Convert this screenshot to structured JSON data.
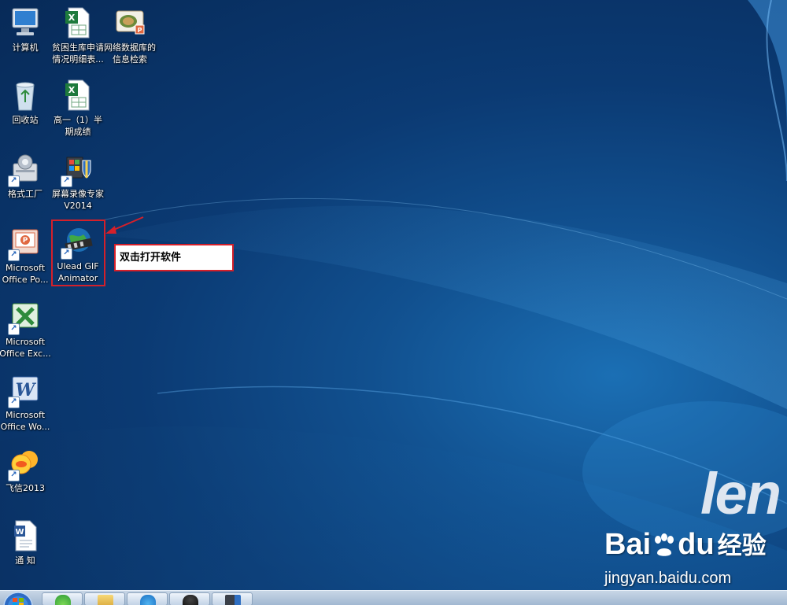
{
  "desktop": {
    "icons": [
      {
        "label": "计算机",
        "icon": "computer-icon"
      },
      {
        "label": "贫困生库申请\n情况明细表...",
        "icon": "excel-file-icon"
      },
      {
        "label": "网络数据库的\n信息检索",
        "icon": "ppt-file-icon"
      },
      {
        "label": "回收站",
        "icon": "recycle-bin-icon"
      },
      {
        "label": "高一（1）半\n期成绩",
        "icon": "excel-file-icon"
      },
      {
        "label": "格式工厂",
        "icon": "format-factory-icon"
      },
      {
        "label": "屏幕录像专家\nV2014",
        "icon": "screen-recorder-icon"
      },
      {
        "label": "Microsoft\nOffice Po...",
        "icon": "powerpoint-icon"
      },
      {
        "label": "Ulead GIF\nAnimator",
        "icon": "ulead-gif-animator-icon"
      },
      {
        "label": "Microsoft\nOffice Exc...",
        "icon": "excel-icon"
      },
      {
        "label": "Microsoft\nOffice Wo...",
        "icon": "word-icon"
      },
      {
        "label": "飞信2013",
        "icon": "fetion-icon"
      },
      {
        "label": "通  知",
        "icon": "word-file-icon"
      }
    ]
  },
  "annotation": {
    "callout_text": "双击打开软件",
    "border_color": "#d4202a"
  },
  "wallpaper": {
    "brand": "len"
  },
  "watermark": {
    "logo_bai": "Bai",
    "logo_du": "du",
    "logo_zh": "经验",
    "url": "jingyan.baidu.com"
  },
  "taskbar": {
    "items": [
      "start-orb",
      "360-browser-icon",
      "file-explorer-icon",
      "kugou-icon",
      "qq-icon",
      "screen-recorder-icon"
    ]
  }
}
